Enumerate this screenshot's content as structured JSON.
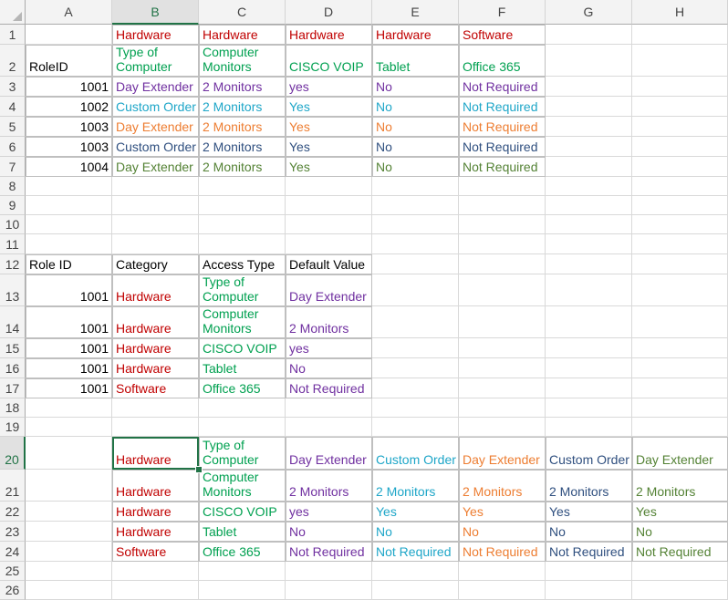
{
  "columns": [
    "A",
    "B",
    "C",
    "D",
    "E",
    "F",
    "G",
    "H"
  ],
  "rows": [
    "1",
    "2",
    "3",
    "4",
    "5",
    "6",
    "7",
    "8",
    "9",
    "10",
    "11",
    "12",
    "13",
    "14",
    "15",
    "16",
    "17",
    "18",
    "19",
    "20",
    "21",
    "22",
    "23",
    "24",
    "25",
    "26"
  ],
  "selected": {
    "column": "B",
    "row": "20"
  },
  "colors": {
    "red": "#c00000",
    "green": "#00a050",
    "purple": "#7030a0",
    "teal": "#1ea6c8",
    "orange": "#ed7d31",
    "navy": "#2f4f7f",
    "olive": "#548235",
    "black": "#000000"
  },
  "table1": {
    "header_row1": [
      "",
      "Hardware",
      "Hardware",
      "Hardware",
      "Hardware",
      "Software"
    ],
    "header_row2": [
      "RoleID",
      "Type of Computer",
      "Computer Monitors",
      "CISCO VOIP",
      "Tablet",
      "Office 365"
    ],
    "rows": [
      [
        "1001",
        "Day Extender",
        "2 Monitors",
        "yes",
        "No",
        "Not Required"
      ],
      [
        "1002",
        "Custom Order",
        "2 Monitors",
        "Yes",
        "No",
        "Not Required"
      ],
      [
        "1003",
        "Day Extender",
        "2 Monitors",
        "Yes",
        "No",
        "Not Required"
      ],
      [
        "1003",
        "Custom Order",
        "2 Monitors",
        "Yes",
        "No",
        "Not Required"
      ],
      [
        "1004",
        "Day Extender",
        "2 Monitors",
        "Yes",
        "No",
        "Not Required"
      ]
    ]
  },
  "table2": {
    "headers": [
      "Role ID",
      "Category",
      "Access Type",
      "Default Value"
    ],
    "rows": [
      [
        "1001",
        "Hardware",
        "Type of Computer",
        "Day Extender"
      ],
      [
        "1001",
        "Hardware",
        "Computer Monitors",
        "2 Monitors"
      ],
      [
        "1001",
        "Hardware",
        "CISCO VOIP",
        "yes"
      ],
      [
        "1001",
        "Hardware",
        "Tablet",
        "No"
      ],
      [
        "1001",
        "Software",
        "Office 365",
        "Not Required"
      ]
    ]
  },
  "table3": {
    "rows": [
      [
        "Hardware",
        "Type of Computer",
        "Day Extender",
        "Custom Order",
        "Day Extender",
        "Custom Order",
        "Day Extender"
      ],
      [
        "Hardware",
        "Computer Monitors",
        "2 Monitors",
        "2 Monitors",
        "2 Monitors",
        "2 Monitors",
        "2 Monitors"
      ],
      [
        "Hardware",
        "CISCO VOIP",
        "yes",
        "Yes",
        "Yes",
        "Yes",
        "Yes"
      ],
      [
        "Hardware",
        "Tablet",
        "No",
        "No",
        "No",
        "No",
        "No"
      ],
      [
        "Software",
        "Office 365",
        "Not Required",
        "Not Required",
        "Not Required",
        "Not Required",
        "Not Required"
      ]
    ]
  }
}
